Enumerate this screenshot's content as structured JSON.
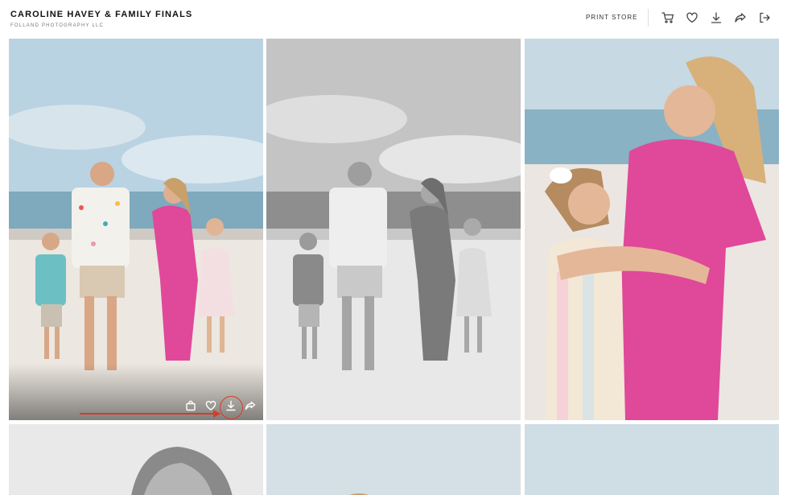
{
  "header": {
    "title": "CAROLINE HAVEY & FAMILY FINALS",
    "subtitle": "FOLLAND PHOTOGRAPHY LLC",
    "print_store_label": "PRINT STORE",
    "icons": [
      "cart-icon",
      "heart-icon",
      "download-icon",
      "share-icon",
      "logout-icon"
    ]
  },
  "photo_actions": {
    "icons": [
      "bag-icon",
      "heart-icon",
      "download-icon",
      "share-icon"
    ],
    "highlighted": "download-icon"
  },
  "colors": {
    "annotation": "#d63b2a",
    "dress_pink": "#e0489a",
    "sky": "#b9d3e2",
    "sea": "#7fa9bd",
    "sand": "#ece7e0"
  }
}
